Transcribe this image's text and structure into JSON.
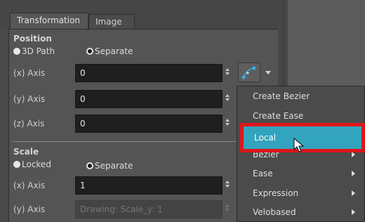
{
  "tabs": [
    {
      "label": "Transformation",
      "active": true
    },
    {
      "label": "Image",
      "active": false
    }
  ],
  "position": {
    "title": "Position",
    "options": [
      {
        "label": "3D Path",
        "selected": false
      },
      {
        "label": "Separate",
        "selected": true
      }
    ],
    "axes": [
      {
        "label": "(x) Axis",
        "value": "0"
      },
      {
        "label": "(y) Axis",
        "value": "0"
      },
      {
        "label": "(z) Axis",
        "value": "0"
      }
    ]
  },
  "scale": {
    "title": "Scale",
    "options": [
      {
        "label": "Locked",
        "selected": false
      },
      {
        "label": "Separate",
        "selected": true
      }
    ],
    "axes": [
      {
        "label": "(x) Axis",
        "value": "1",
        "placeholder": ""
      },
      {
        "label": "(y) Axis",
        "value": "",
        "placeholder": "Drawing: Scale_y: 1",
        "disabled": true
      }
    ]
  },
  "function_button": {
    "icon": "bezier-curve-icon",
    "dropdown_icon": "chevron-down-icon"
  },
  "menu": {
    "items": [
      {
        "label": "Create Bezier",
        "has_submenu": false
      },
      {
        "label": "Create Ease",
        "has_submenu": false
      },
      {
        "label": "Local",
        "has_submenu": false,
        "highlighted": true
      },
      {
        "label": "Bezier",
        "has_submenu": true
      },
      {
        "label": "Ease",
        "has_submenu": true
      },
      {
        "label": "Expression",
        "has_submenu": true
      },
      {
        "label": "Velobased",
        "has_submenu": true
      }
    ]
  },
  "colors": {
    "highlight": "#33a4bd",
    "annotation_box": "#e0151b",
    "field_bg": "#1f1f1f",
    "panel_bg": "#545454"
  }
}
